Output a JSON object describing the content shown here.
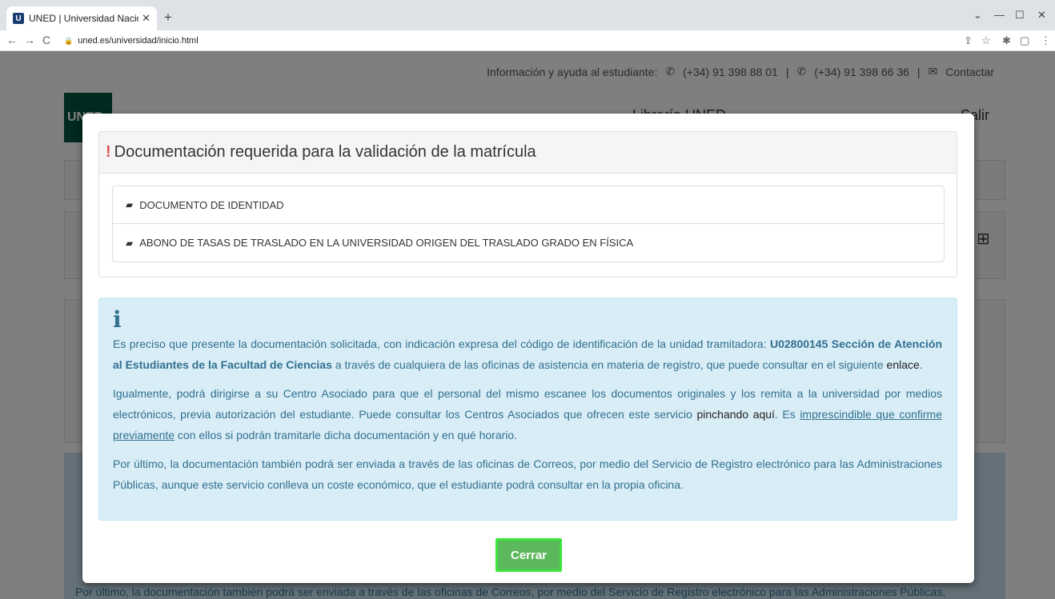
{
  "browser": {
    "tab_title": "UNED | Universidad Nacio",
    "tab_favicon": "U",
    "url": "uned.es/universidad/inicio.html"
  },
  "page": {
    "topbar": {
      "label": "Información y ayuda al estudiante:",
      "phone1": "(+34) 91 398 88 01",
      "phone2": "(+34) 91 398 66 36",
      "contact": "Contactar",
      "separator": "|"
    },
    "logo_text": "UNED",
    "nav": {
      "libreria": "Librería UNED",
      "salir": "Salir"
    },
    "bg_info_lines": [
      "Por último, la documentación también podrá ser enviada a través de las oficinas de Correos, por medio del Servicio de Registro electrónico para las Administraciones Públicas,"
    ]
  },
  "modal": {
    "title": "Documentación requerida para la validación de la matrícula",
    "title_mark": "!",
    "documents": [
      "DOCUMENTO DE IDENTIDAD",
      "ABONO DE TASAS DE TRASLADO EN LA UNIVERSIDAD ORIGEN DEL TRASLADO GRADO EN FÍSICA"
    ],
    "info": {
      "icon": "i",
      "p1_a": "Es preciso que presente la documentación solicitada, con indicación expresa del código de identificación de la unidad tramitadora: ",
      "p1_bold": "U02800145 Sección de Atención al Estudiantes de la Facultad de Ciencias",
      "p1_b": " a través de cualquiera de las oficinas de asistencia en materia de registro, que puede consultar en el siguiente ",
      "p1_link": "enlace",
      "p1_end": ".",
      "p2_a": "Igualmente, podrá dirigirse a su Centro Asociado para que el personal del mismo escanee los documentos originales y los remita a la universidad por medios electrónicos, previa autorización del estudiante. Puede consultar los Centros Asociados que ofrecen este servicio ",
      "p2_link": "pinchando aquí",
      "p2_b": ". Es ",
      "p2_underline": "imprescindible que confirme previamente",
      "p2_c": " con ellos si podrán tramitarle dicha documentación y en qué horario.",
      "p3": "Por último, la documentación también podrá ser enviada a través de las oficinas de Correos, por medio del Servicio de Registro electrónico para las Administraciones Públicas, aunque este servicio conlleva un coste económico, que el estudiante podrá consultar en la propia oficina."
    },
    "close_label": "Cerrar"
  },
  "colors": {
    "accent_green": "#5cb85c",
    "info_bg": "#d9edf7",
    "info_text": "#31708f",
    "danger": "#d9534f"
  }
}
